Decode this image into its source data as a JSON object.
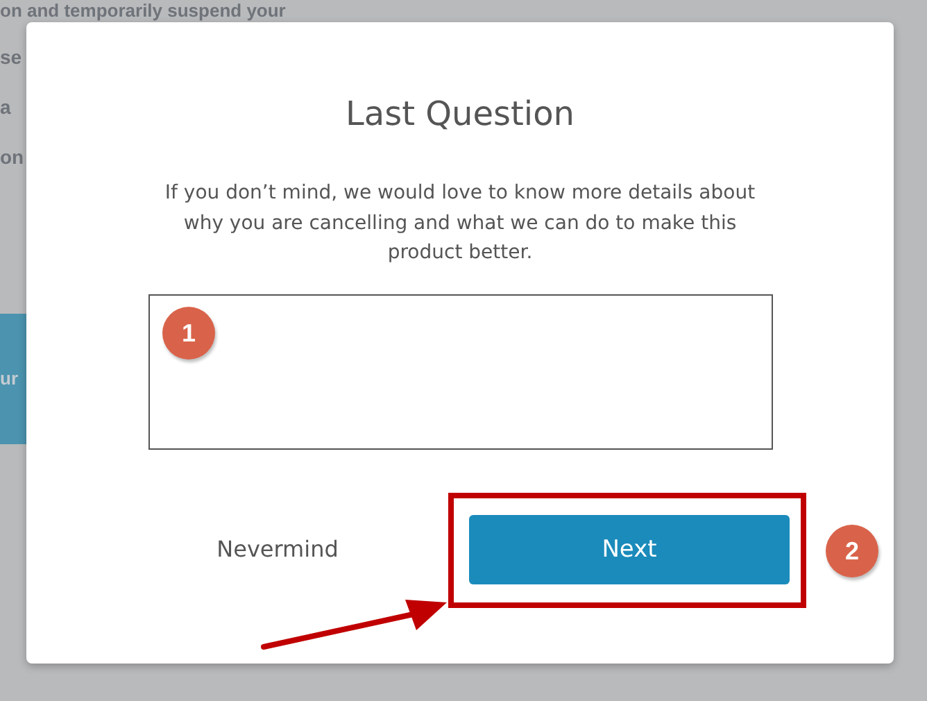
{
  "background": {
    "lines": [
      "on and temporarily suspend your",
      "se",
      "a",
      "on"
    ],
    "button_text": "ur"
  },
  "dialog": {
    "title": "Last Question",
    "message": "If you don’t mind, we would love to know more details about why you are cancelling and what we can do to make this product better.",
    "buttons": [
      {
        "label": "Nevermind",
        "kind": "link"
      },
      {
        "label": "Next",
        "kind": "primary"
      }
    ]
  },
  "annotations": [
    {
      "kind": "badge",
      "text": "1"
    },
    {
      "kind": "highlight"
    },
    {
      "kind": "badge",
      "text": "2"
    },
    {
      "kind": "arrow"
    }
  ]
}
